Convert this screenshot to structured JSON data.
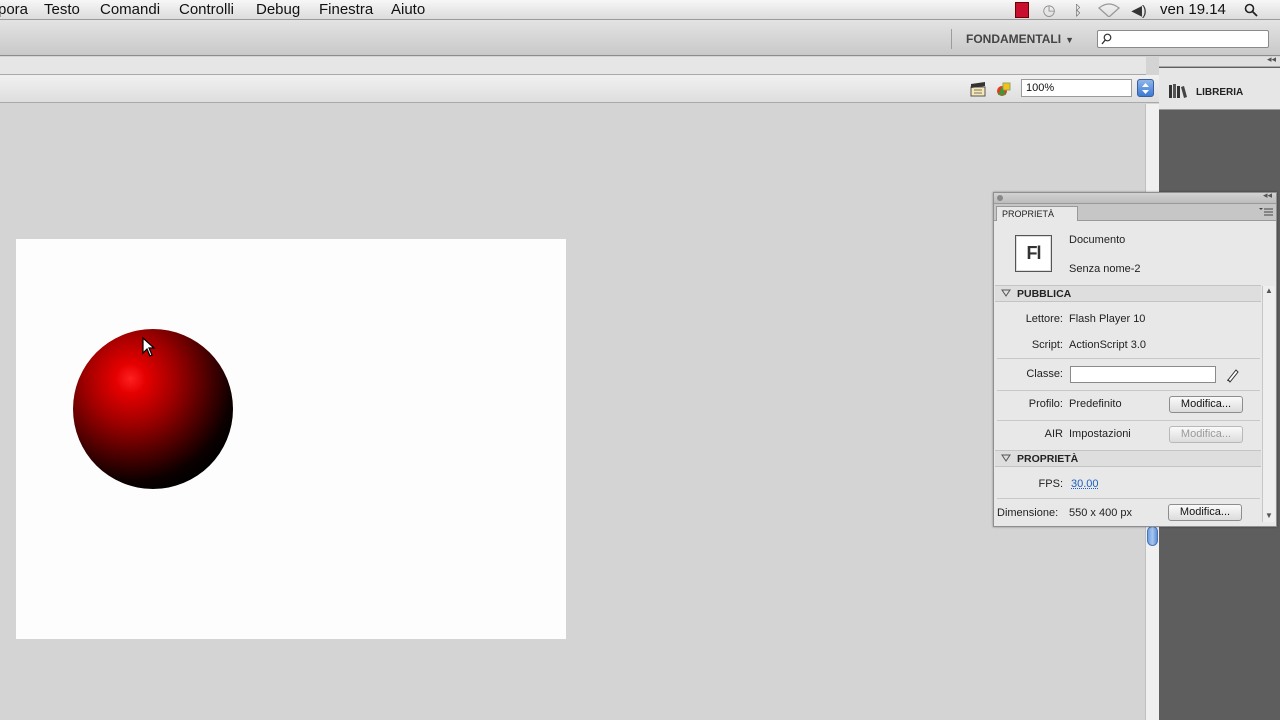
{
  "menubar": {
    "items": [
      "pora",
      "Testo",
      "Comandi",
      "Controlli",
      "Debug",
      "Finestra",
      "Aiuto"
    ],
    "clock": "ven 19.14",
    "tray_icons": [
      "flash-player-icon",
      "time-machine-icon",
      "bluetooth-icon",
      "wifi-icon",
      "volume-icon",
      "spotlight-icon"
    ]
  },
  "appbar": {
    "workspace": "FONDAMENTALI",
    "search_value": ""
  },
  "editbar": {
    "zoom": "100%"
  },
  "dock": {
    "library_label": "LIBRERIA"
  },
  "properties": {
    "tab_label": "PROPRIETÀ",
    "doc_icon_text": "Fl",
    "doc_type": "Documento",
    "doc_name": "Senza nome-2",
    "publish": {
      "title": "PUBBLICA",
      "player_label": "Lettore:",
      "player_value": "Flash Player 10",
      "script_label": "Script:",
      "script_value": "ActionScript 3.0",
      "class_label": "Classe:",
      "class_value": "",
      "profile_label": "Profilo:",
      "profile_value": "Predefinito",
      "profile_button": "Modifica...",
      "air_label": "AIR",
      "air_value": "Impostazioni",
      "air_button": "Modifica..."
    },
    "props": {
      "title": "PROPRIETÀ",
      "fps_label": "FPS:",
      "fps_value": "30.00",
      "size_label": "Dimensione:",
      "size_value": "550 x 400 px",
      "size_button": "Modifica..."
    }
  },
  "colors": {
    "ball_highlight": "#ff2020",
    "ball_shadow": "#000000",
    "stage_bg": "#fdfdfd",
    "pasteboard_bg": "#d4d4d4",
    "dock_bg": "#5e5e5e",
    "link": "#1a5fc0"
  }
}
